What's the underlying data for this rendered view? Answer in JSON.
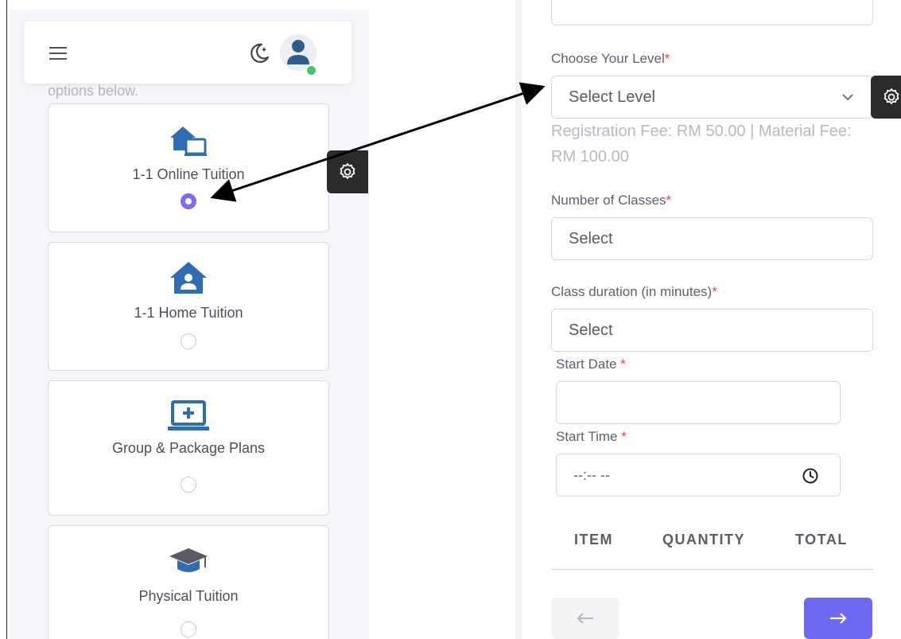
{
  "left": {
    "helper_text": "options below.",
    "plans": [
      {
        "label": "1-1 Online Tuition",
        "selected": true,
        "icon": "online-tuition-icon"
      },
      {
        "label": "1-1 Home Tuition",
        "selected": false,
        "icon": "home-tuition-icon"
      },
      {
        "label": "Group & Package Plans",
        "selected": false,
        "icon": "group-plan-icon"
      },
      {
        "label": "Physical Tuition",
        "selected": false,
        "icon": "graduation-cap-icon"
      }
    ]
  },
  "form": {
    "level_label": "Choose Your Level",
    "level_value": "Select Level",
    "fee_text": "Registration Fee: RM 50.00 | Material Fee: RM 100.00",
    "classes_label": "Number of Classes",
    "classes_value": "Select",
    "duration_label": "Class duration (in minutes)",
    "duration_value": "Select",
    "date_label": "Start Date",
    "date_value": "",
    "time_label": "Start Time",
    "time_value": "--:-- --",
    "required_mark": "*"
  },
  "summary": {
    "col_item": "ITEM",
    "col_quantity": "QUANTITY",
    "col_total": "TOTAL"
  },
  "colors": {
    "accent": "#6e67f2",
    "radio_checked": "#7b6cf6",
    "icon_blue": "#2f6db0",
    "required": "#e3464d",
    "status_online": "#4cc26b"
  }
}
